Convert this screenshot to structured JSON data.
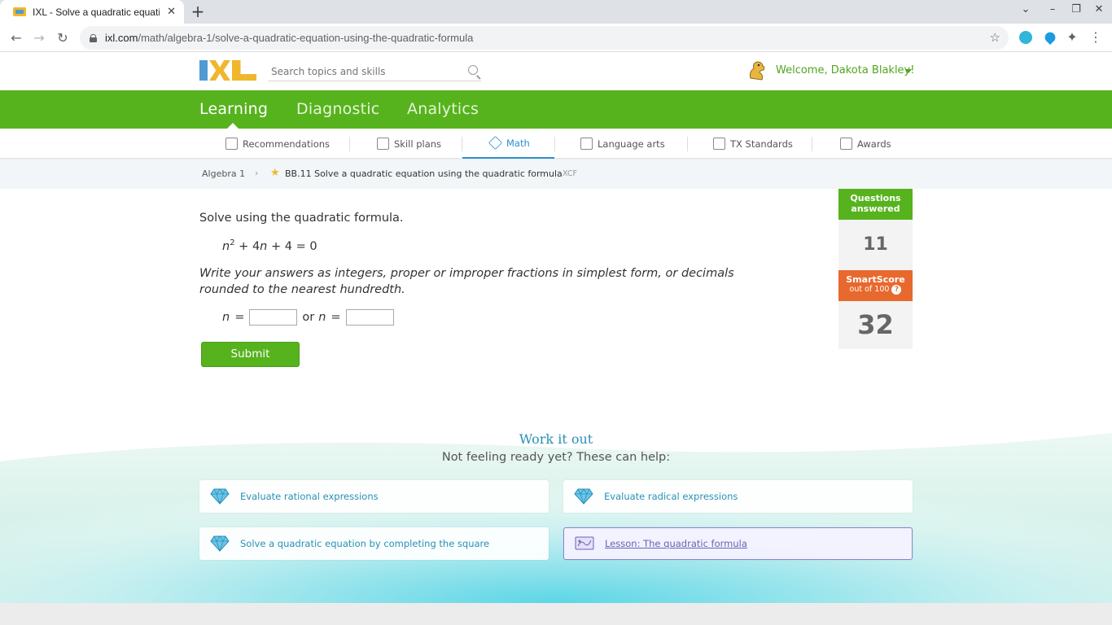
{
  "browser": {
    "tab_title": "IXL - Solve a quadratic equation",
    "close_glyph": "✕",
    "new_tab_glyph": "+",
    "url_host": "ixl.com",
    "url_path": "/math/algebra-1/solve-a-quadratic-equation-using-the-quadratic-formula"
  },
  "header": {
    "search_placeholder": "Search topics and skills",
    "welcome": "Welcome, Dakota Blakley!"
  },
  "main_nav": {
    "items": [
      "Learning",
      "Diagnostic",
      "Analytics"
    ]
  },
  "sub_nav": {
    "items": [
      "Recommendations",
      "Skill plans",
      "Math",
      "Language arts",
      "TX Standards",
      "Awards"
    ],
    "active": "Math"
  },
  "breadcrumb": {
    "course": "Algebra 1",
    "skill": "BB.11 Solve a quadratic equation using the quadratic formula",
    "code": "XCF"
  },
  "question": {
    "prompt": "Solve using the quadratic formula.",
    "equation_var": "n",
    "equation_exp": "2",
    "equation_rest": " + 4",
    "equation_var2": "n",
    "equation_tail": " + 4 = 0",
    "instructions": "Write your answers as integers, proper or improper fractions in simplest form, or decimals rounded to the nearest hundredth.",
    "var": "n",
    "equals": "=",
    "or": "or",
    "answer_1": "",
    "answer_2": "",
    "submit_label": "Submit"
  },
  "stats": {
    "questions_label": "Questions answered",
    "questions_value": "11",
    "smartscore_label": "SmartScore",
    "smartscore_sub": "out of 100",
    "help_glyph": "?",
    "smartscore_value": "32"
  },
  "work_it_out": {
    "title": "Work it out",
    "subtitle": "Not feeling ready yet? These can help:",
    "cards": [
      {
        "label": "Evaluate rational expressions",
        "icon": "gem-icon"
      },
      {
        "label": "Evaluate radical expressions",
        "icon": "gem-icon"
      },
      {
        "label": "Solve a quadratic equation by completing the square",
        "icon": "gem-icon"
      },
      {
        "label": "Lesson: The quadratic formula",
        "icon": "lesson-icon"
      }
    ]
  },
  "colors": {
    "ixl_green": "#56b31d",
    "smartscore_orange": "#e8692e",
    "link_blue": "#2a8fb5"
  }
}
